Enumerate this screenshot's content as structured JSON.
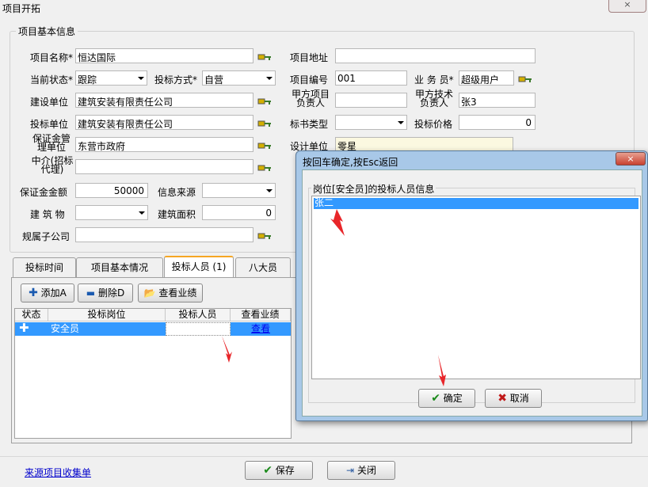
{
  "window": {
    "title": "项目开拓",
    "close_glyph": "×"
  },
  "group": {
    "title": "项目基本信息"
  },
  "form": {
    "project_name_label": "项目名称*",
    "project_name": "恒达国际",
    "project_address_label": "项目地址",
    "project_address": "",
    "status_label": "当前状态*",
    "status": "跟踪",
    "bid_method_label": "投标方式*",
    "bid_method": "自营",
    "project_no_label": "项目编号",
    "project_no": "001",
    "salesman_label": "业 务 员*",
    "salesman": "超级用户",
    "builder_label": "建设单位",
    "builder": "建筑安装有限责任公司",
    "client_pm_label": "甲方项目负责人",
    "client_pm": "",
    "client_tech_label": "甲方技术负责人",
    "client_tech": "张3",
    "bidder_label": "投标单位",
    "bidder": "建筑安装有限责任公司",
    "tender_type_label": "标书类型",
    "tender_type": "",
    "bid_price_label": "投标价格",
    "bid_price": "0",
    "guarantee_mgr_label": "保证金管理单位",
    "guarantee_mgr": "东营市政府",
    "design_unit_label": "设计单位",
    "design_unit": "零星",
    "agent_label": "中介(招标代理)",
    "agent": "",
    "deposit_label": "保证金金额",
    "deposit": "50000",
    "info_source_label": "信息来源",
    "info_source": "",
    "building_label": "建 筑 物",
    "building": "",
    "building_area_label": "建筑面积",
    "building_area": "0",
    "subsidiary_label": "规属子公司",
    "subsidiary": ""
  },
  "tabs": [
    {
      "label": "投标时间"
    },
    {
      "label": "项目基本情况"
    },
    {
      "label": "投标人员 (1)"
    },
    {
      "label": "八大员"
    }
  ],
  "toolbar": {
    "add": "添加A",
    "delete": "删除D",
    "view": "查看业绩"
  },
  "grid": {
    "headers": [
      "状态",
      "投标岗位",
      "投标人员",
      "查看业绩"
    ],
    "rows": [
      {
        "position": "安全员",
        "person": "",
        "link": "查看"
      }
    ]
  },
  "footer": {
    "link": "来源项目收集单",
    "save": "保存",
    "close": "关闭"
  },
  "dialog": {
    "title": "按回车确定,按Esc返回",
    "group_title": "岗位[安全员]的投标人员信息",
    "selected_person": "张二",
    "ok": "确定",
    "cancel": "取消",
    "close_glyph": "×"
  },
  "colors": {
    "selection": "#3399ff",
    "arrow": "#e8262a",
    "active_tab": "#f5a623"
  }
}
